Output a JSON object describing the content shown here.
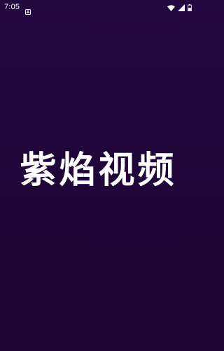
{
  "status_bar": {
    "time": "7:05",
    "icons": [
      "notification-app-icon",
      "wifi-icon",
      "cellular-signal-icon",
      "battery-icon"
    ]
  },
  "splash": {
    "title": "紫焰视频"
  },
  "colors": {
    "background_top": "#240840",
    "background_bottom": "#1d0633",
    "text": "#ffffff"
  }
}
